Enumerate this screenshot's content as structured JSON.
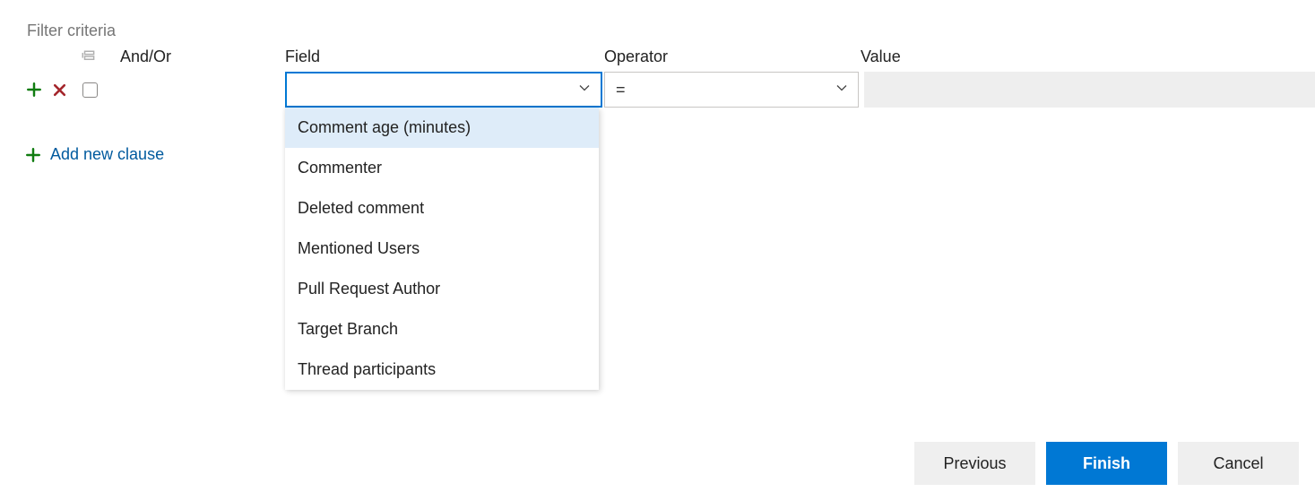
{
  "title": "Filter criteria",
  "headers": {
    "andor": "And/Or",
    "field": "Field",
    "operator": "Operator",
    "value": "Value"
  },
  "row": {
    "operator_value": "="
  },
  "field_options": [
    "Comment age (minutes)",
    "Commenter",
    "Deleted comment",
    "Mentioned Users",
    "Pull Request Author",
    "Target Branch",
    "Thread participants"
  ],
  "add_clause_label": "Add new clause",
  "buttons": {
    "previous": "Previous",
    "finish": "Finish",
    "cancel": "Cancel"
  }
}
